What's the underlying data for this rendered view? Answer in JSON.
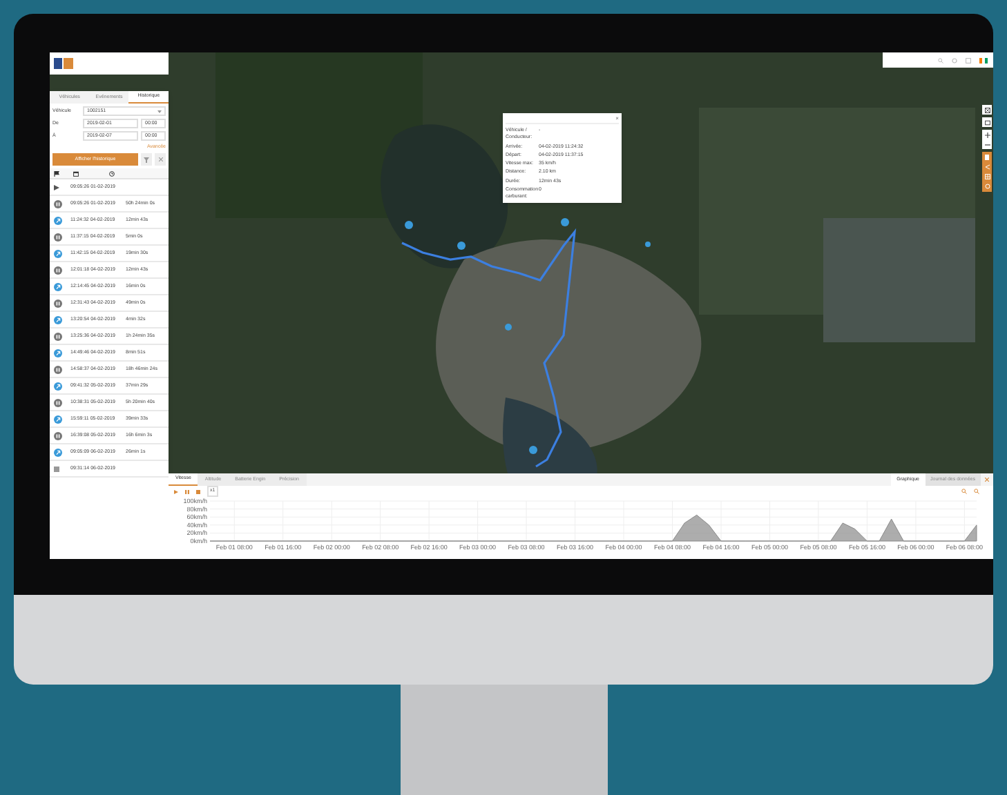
{
  "sidebar": {
    "tabs": [
      {
        "label": "Véhicules",
        "selected": false
      },
      {
        "label": "Evénements",
        "selected": false
      },
      {
        "label": "Historique",
        "selected": true
      }
    ],
    "form": {
      "vehicle_label": "Véhicule",
      "vehicle_value": "1002151",
      "from_label": "De",
      "from_date": "2019-02-01",
      "from_time": "00:00",
      "to_label": "À",
      "to_date": "2019-02-07",
      "to_time": "00:00",
      "advanced_link": "Avancée",
      "show_button": "Afficher l'historique"
    },
    "rows": [
      {
        "kind": "start",
        "time": "09:05:26 01-02-2019"
      },
      {
        "kind": "stop",
        "time": "09:05:26 01-02-2019",
        "duration": "50h 24min 0s"
      },
      {
        "kind": "moving",
        "time": "11:24:32 04-02-2019",
        "duration": "12min 43s"
      },
      {
        "kind": "stop",
        "time": "11:37:15 04-02-2019",
        "duration": "5min 0s"
      },
      {
        "kind": "moving",
        "time": "11:42:15 04-02-2019",
        "duration": "19min 30s"
      },
      {
        "kind": "stop",
        "time": "12:01:18 04-02-2019",
        "duration": "12min 43s"
      },
      {
        "kind": "moving",
        "time": "12:14:45 04-02-2019",
        "duration": "16min 0s"
      },
      {
        "kind": "stop",
        "time": "12:31:43 04-02-2019",
        "duration": "49min 0s"
      },
      {
        "kind": "moving",
        "time": "13:20:54 04-02-2019",
        "duration": "4min 32s"
      },
      {
        "kind": "stop",
        "time": "13:25:36 04-02-2019",
        "duration": "1h 24min 35s"
      },
      {
        "kind": "moving",
        "time": "14:49:46 04-02-2019",
        "duration": "8min 51s"
      },
      {
        "kind": "stop",
        "time": "14:58:37 04-02-2019",
        "duration": "18h 46min 24s"
      },
      {
        "kind": "moving",
        "time": "09:41:32 05-02-2019",
        "duration": "37min 29s"
      },
      {
        "kind": "stop",
        "time": "10:38:31 05-02-2019",
        "duration": "5h 20min 40s"
      },
      {
        "kind": "moving",
        "time": "15:59:11 05-02-2019",
        "duration": "39min 33s"
      },
      {
        "kind": "stop",
        "time": "16:39:08 05-02-2019",
        "duration": "16h 6min 3s"
      },
      {
        "kind": "moving",
        "time": "09:05:09 06-02-2019",
        "duration": "26min 1s"
      },
      {
        "kind": "end",
        "time": "09:31:14 06-02-2019"
      }
    ]
  },
  "popup": {
    "close": "×",
    "fields": [
      {
        "label": "Véhicule / Conducteur:",
        "value": "-"
      },
      {
        "label": "Arrivée:",
        "value": "04-02-2019 11:24:32"
      },
      {
        "label": "Départ:",
        "value": "04-02-2019 11:37:15"
      },
      {
        "label": "Vitesse max:",
        "value": "35 km/h"
      },
      {
        "label": "Distance:",
        "value": "2.10 km"
      },
      {
        "label": "Durée:",
        "value": "12min 43s"
      },
      {
        "label": "Consommation carburant:",
        "value": "0"
      }
    ]
  },
  "bottom": {
    "tabs": [
      {
        "label": "Vitesse",
        "selected": true
      },
      {
        "label": "Altitude",
        "selected": false
      },
      {
        "label": "Batterie Engin",
        "selected": false
      },
      {
        "label": "Précision",
        "selected": false
      }
    ],
    "views": [
      {
        "label": "Graphique",
        "selected": true
      },
      {
        "label": "Journal des données",
        "selected": false
      }
    ],
    "speed": "x1",
    "chart_data": {
      "type": "area",
      "categories": [
        null,
        null,
        "Feb 01 08:00",
        null,
        null,
        null,
        "Feb 01 16:00",
        null,
        null,
        null,
        "Feb 02 00:00",
        null,
        null,
        null,
        "Feb 02 08:00",
        null,
        null,
        null,
        "Feb 02 16:00",
        null,
        null,
        null,
        "Feb 03 00:00",
        null,
        null,
        null,
        "Feb 03 08:00",
        null,
        null,
        null,
        "Feb 03 16:00",
        null,
        null,
        null,
        "Feb 04 00:00",
        null,
        null,
        null,
        "Feb 04 08:00",
        null,
        null,
        null,
        "Feb 04 16:00",
        null,
        null,
        null,
        "Feb 05 00:00",
        null,
        null,
        null,
        "Feb 05 08:00",
        null,
        null,
        null,
        "Feb 05 16:00",
        null,
        null,
        null,
        "Feb 06 00:00",
        null,
        null,
        null,
        "Feb 06 08:00",
        null
      ],
      "series": [
        {
          "color": "#8a8a8a",
          "values": [
            0,
            0,
            0,
            0,
            0,
            0,
            0,
            0,
            0,
            0,
            0,
            0,
            0,
            0,
            0,
            0,
            0,
            0,
            0,
            0,
            0,
            0,
            0,
            0,
            0,
            0,
            0,
            0,
            0,
            0,
            0,
            0,
            0,
            0,
            0,
            0,
            0,
            0,
            0,
            45,
            65,
            40,
            0,
            0,
            0,
            0,
            0,
            0,
            0,
            0,
            0,
            0,
            45,
            30,
            0,
            0,
            55,
            0,
            0,
            0,
            0,
            0,
            0,
            40
          ]
        }
      ],
      "ylim": [
        0,
        100
      ],
      "grid": true,
      "yticks": [
        {
          "value": 0,
          "label": "0km/h"
        },
        {
          "value": 20,
          "label": "20km/h"
        },
        {
          "value": 40,
          "label": "40km/h"
        },
        {
          "value": 60,
          "label": "60km/h"
        },
        {
          "value": 80,
          "label": "80km/h"
        },
        {
          "value": 100,
          "label": "100km/h"
        }
      ]
    }
  }
}
